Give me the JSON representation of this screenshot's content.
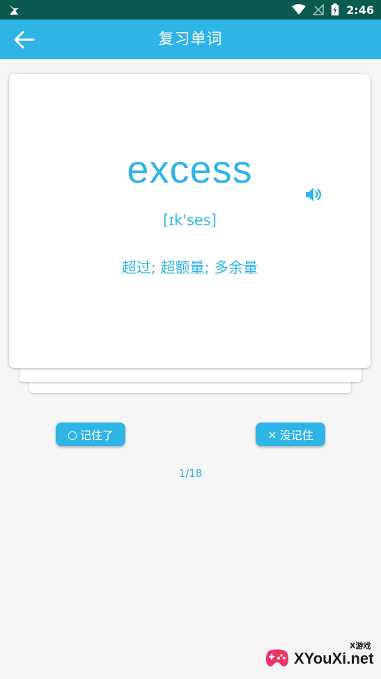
{
  "status_bar": {
    "time": "2:46",
    "icons": [
      "notification-icon",
      "wifi-icon",
      "no-signal-icon",
      "battery-charging-icon"
    ]
  },
  "app_bar": {
    "title": "复习单词",
    "back_icon": "arrow-left-icon"
  },
  "card": {
    "word": "excess",
    "phonetic": "[ɪk'ses]",
    "meaning": "超过; 超额量; 多余量",
    "speaker_icon": "speaker-icon"
  },
  "actions": {
    "remembered_glyph": "○",
    "remembered_label": "记住了",
    "forgot_glyph": "×",
    "forgot_label": "没记住"
  },
  "progress": "1/18",
  "watermark": {
    "text": "XYouXi.net",
    "small_text": "X游戏"
  },
  "colors": {
    "accent": "#2fb4e6",
    "status_bar": "#0b5a4f",
    "background": "#f5f5f5",
    "card": "#ffffff"
  }
}
